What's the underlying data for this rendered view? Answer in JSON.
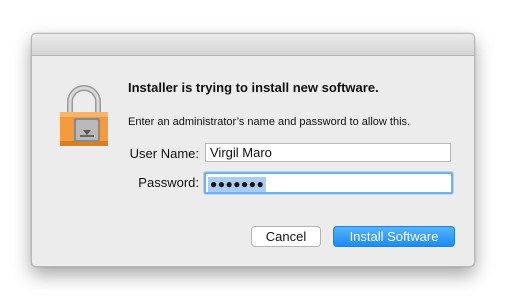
{
  "dialog": {
    "heading": "Installer is trying to install new software.",
    "info": "Enter an administrator’s name and password to allow this.",
    "username_label": "User Name:",
    "username_value": "Virgil Maro",
    "password_label": "Password:",
    "password_masked": "●●●●●●●"
  },
  "buttons": {
    "cancel_label": "Cancel",
    "install_label": "Install Software"
  },
  "icons": {
    "dialog_icon": "installer-lock-icon"
  },
  "colors": {
    "accent": "#1a8cf7",
    "lock_body": "#f39a3c",
    "selection": "#a9cdf5"
  }
}
